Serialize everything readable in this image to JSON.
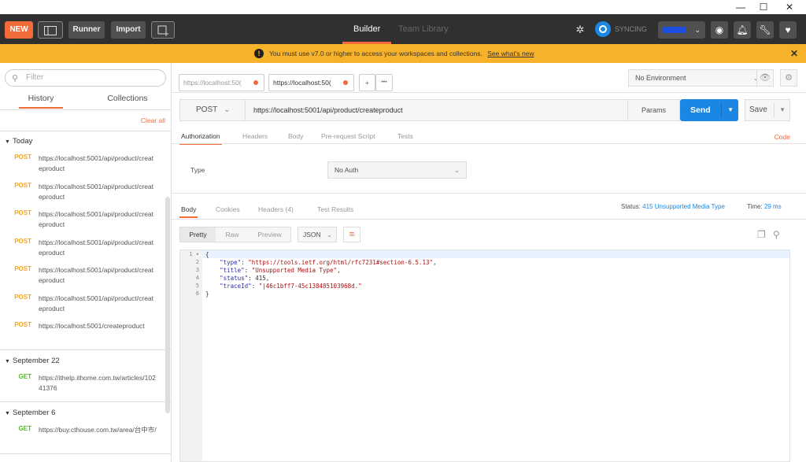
{
  "window": {
    "minimize": "—",
    "maximize": "☐",
    "close": "✕"
  },
  "header": {
    "new_label": "NEW",
    "runner_label": "Runner",
    "import_label": "Import",
    "tabs": [
      {
        "label": "Builder",
        "active": true
      },
      {
        "label": "Team Library",
        "active": false
      }
    ],
    "sync_label": "SYNCING"
  },
  "banner": {
    "message": "You must use v7.0 or higher to access your workspaces and collections.",
    "link": "See what's new",
    "close": "✕"
  },
  "sidebar": {
    "filter_placeholder": "Filter",
    "tabs": [
      "History",
      "Collections"
    ],
    "clear_all": "Clear all",
    "groups": [
      {
        "label": "Today",
        "items": [
          {
            "method": "POST",
            "url": "https://localhost:5001/api/product/createproduct"
          },
          {
            "method": "POST",
            "url": "https://localhost:5001/api/product/createproduct"
          },
          {
            "method": "POST",
            "url": "https://localhost:5001/api/product/createproduct"
          },
          {
            "method": "POST",
            "url": "https://localhost:5001/api/product/createproduct"
          },
          {
            "method": "POST",
            "url": "https://localhost:5001/api/product/createproduct"
          },
          {
            "method": "POST",
            "url": "https://localhost:5001/api/product/createproduct"
          },
          {
            "method": "POST",
            "url": "https://localhost:5001/createproduct"
          }
        ]
      },
      {
        "label": "September 22",
        "items": [
          {
            "method": "GET",
            "url": "https://ithelp.ithome.com.tw/articles/10241376"
          }
        ]
      },
      {
        "label": "September 6",
        "items": [
          {
            "method": "GET",
            "url": "https://buy.cthouse.com.tw/area/台中市/"
          }
        ]
      }
    ]
  },
  "request_tabs": [
    {
      "label": "https://localhost:50("
    },
    {
      "label": "https://localhost:50("
    }
  ],
  "request_tab_actions": {
    "add": "+",
    "more": "•••"
  },
  "environment": {
    "selected": "No Environment"
  },
  "request": {
    "method": "POST",
    "url": "https://localhost:5001/api/product/createproduct",
    "params_label": "Params",
    "send_label": "Send",
    "save_label": "Save"
  },
  "request_subtabs": [
    "Authorization",
    "Headers",
    "Body",
    "Pre-request Script",
    "Tests"
  ],
  "code_link": "Code",
  "auth": {
    "type_label": "Type",
    "selected": "No Auth"
  },
  "response": {
    "tabs": [
      "Body",
      "Cookies",
      "Headers (4)",
      "Test Results"
    ],
    "status_label": "Status:",
    "status_value": "415 Unsupported Media Type",
    "time_label": "Time:",
    "time_value": "29 ms",
    "view_modes": [
      "Pretty",
      "Raw",
      "Preview"
    ],
    "format": "JSON",
    "lines": [
      {
        "n": "1",
        "text": "{"
      },
      {
        "n": "2",
        "key": "\"type\"",
        "val": "\"https://tools.ietf.org/html/rfc7231#section-6.5.13\"",
        "tail": ","
      },
      {
        "n": "3",
        "key": "\"title\"",
        "val": "\"Unsupported Media Type\"",
        "tail": ","
      },
      {
        "n": "4",
        "key": "\"status\"",
        "num": "415",
        "tail": ","
      },
      {
        "n": "5",
        "key": "\"traceId\"",
        "val": "\"|46c1bff7-45c138485103968d.\"",
        "tail": ""
      },
      {
        "n": "6",
        "text": "}"
      }
    ]
  }
}
